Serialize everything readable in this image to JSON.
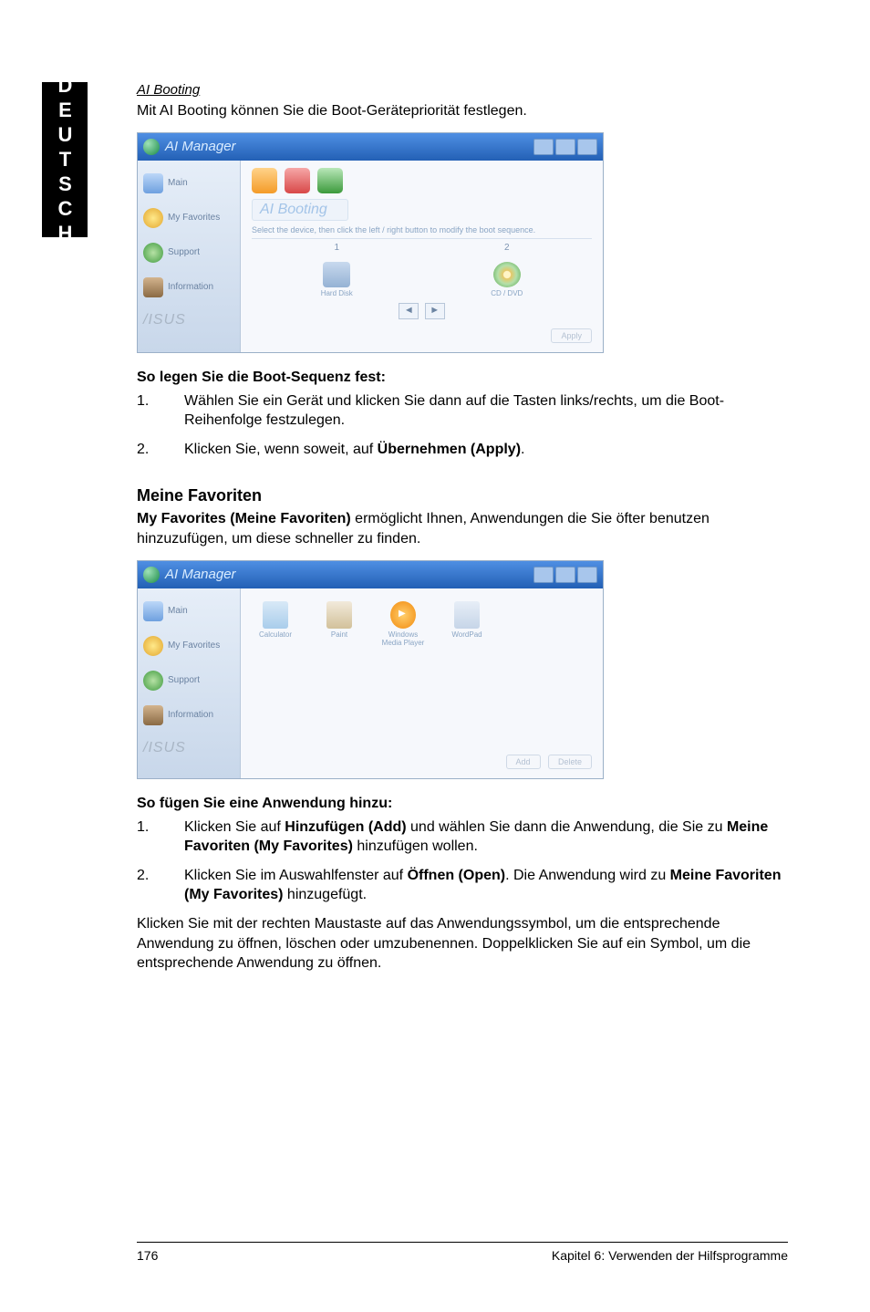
{
  "side_tab": "DEUTSCH",
  "ai_booting": {
    "heading": "AI Booting",
    "intro": "Mit AI Booting können Sie die Boot-Gerätepriorität festlegen.",
    "window": {
      "title": "AI Manager",
      "sidebar": [
        "Main",
        "My Favorites",
        "Support",
        "Information"
      ],
      "footer_logo": "/ISUS",
      "panel_label": "AI Booting",
      "hint": "Select the device, then click the left / right button to modify the boot sequence.",
      "col1": "1",
      "col2": "2",
      "dev1": "Hard Disk",
      "dev2": "CD / DVD",
      "arrow_left": "◄",
      "arrow_right": "►",
      "apply_btn": "Apply"
    },
    "steps_title": "So legen Sie die Boot-Sequenz fest:",
    "steps": [
      "Wählen Sie ein Gerät und klicken Sie dann auf die Tasten links/rechts, um die Boot-Reihenfolge festzulegen.",
      {
        "pre": "Klicken Sie, wenn soweit, auf ",
        "bold": "Übernehmen (Apply)",
        "post": "."
      }
    ]
  },
  "favorites": {
    "heading": "Meine Favoriten",
    "intro_pre": "My Favorites (Meine Favoriten)",
    "intro_post": " ermöglicht Ihnen, Anwendungen die Sie öfter benutzen hinzuzufügen, um diese schneller zu finden.",
    "window": {
      "title": "AI Manager",
      "sidebar": [
        "Main",
        "My Favorites",
        "Support",
        "Information"
      ],
      "footer_logo": "/ISUS",
      "items": [
        {
          "label": "Calculator"
        },
        {
          "label": "Paint"
        },
        {
          "label": "Windows Media Player"
        },
        {
          "label": "WordPad"
        }
      ],
      "add_btn": "Add",
      "delete_btn": "Delete"
    },
    "steps_title": "So fügen Sie eine Anwendung hinzu:",
    "steps": [
      {
        "pre": "Klicken Sie auf ",
        "b1": "Hinzufügen (Add)",
        "mid": " und wählen Sie dann die Anwendung, die Sie zu ",
        "b2": "Meine Favoriten (My Favorites)",
        "post": " hinzufügen wollen."
      },
      {
        "pre": "Klicken Sie im Auswahlfenster auf ",
        "b1": "Öffnen (Open)",
        "mid": ". Die Anwendung wird zu ",
        "b2": "Meine Favoriten (My Favorites)",
        "post": " hinzugefügt."
      }
    ],
    "closing": "Klicken Sie mit der rechten Maustaste auf das Anwendungssymbol, um die entsprechende Anwendung zu öffnen, löschen oder umzubenennen. Doppelklicken Sie auf ein Symbol, um die entsprechende Anwendung zu öffnen."
  },
  "footer": {
    "page_no": "176",
    "chapter": "Kapitel 6: Verwenden der Hilfsprogramme"
  }
}
